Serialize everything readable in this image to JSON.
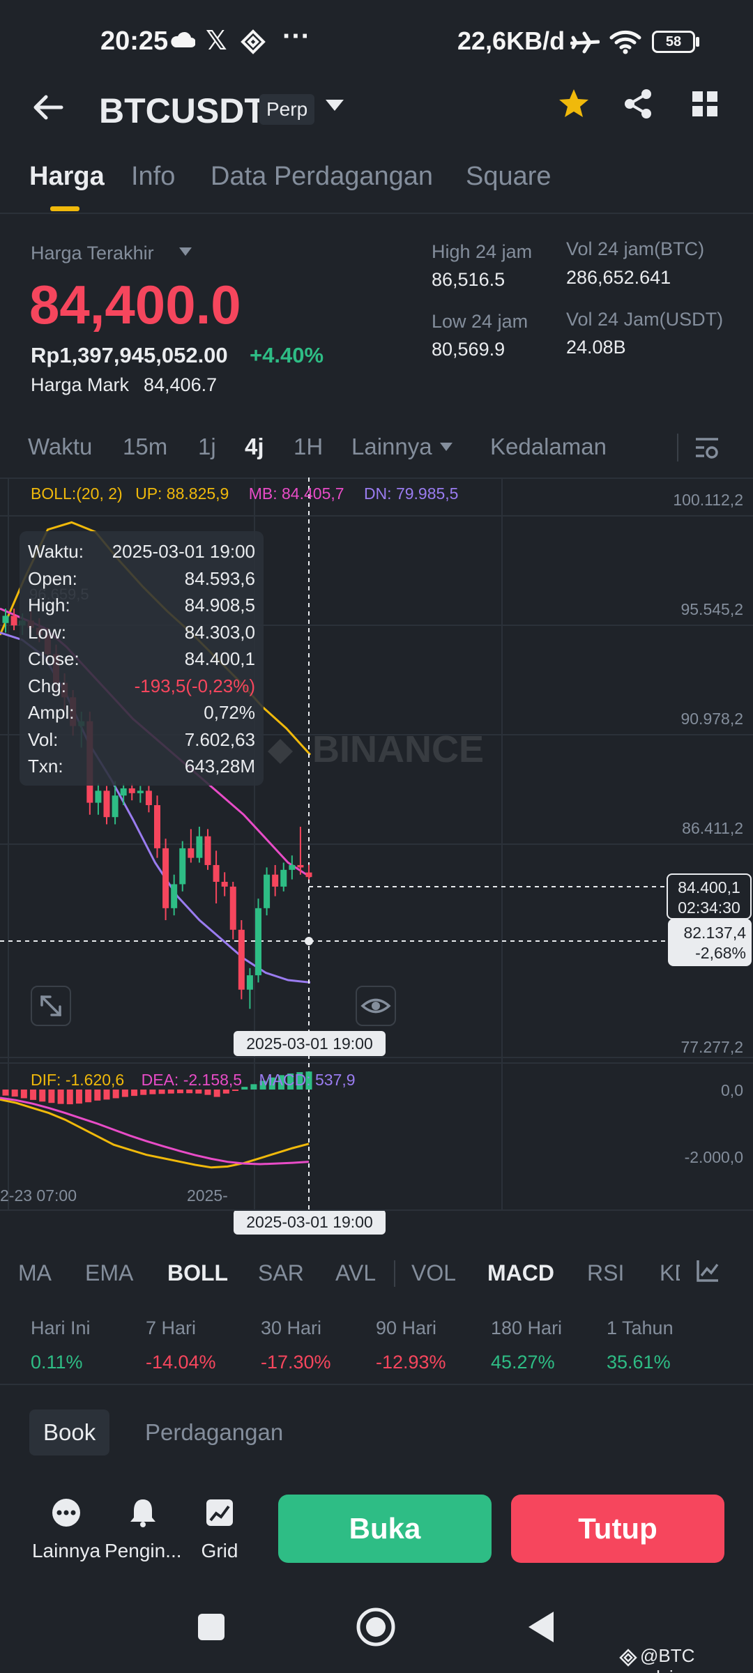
{
  "status_bar": {
    "time": "20:25",
    "network_speed": "22,6KB/d",
    "battery": "58"
  },
  "header": {
    "symbol": "BTCUSDT",
    "badge": "Perp"
  },
  "tabs": [
    {
      "label": "Harga"
    },
    {
      "label": "Info"
    },
    {
      "label": "Data Perdagangan"
    },
    {
      "label": "Square"
    }
  ],
  "price": {
    "last_label": "Harga Terakhir",
    "last_price": "84,400.0",
    "idr_price": "Rp1,397,945,052.00",
    "change_pct": "+4.40%",
    "mark_label": "Harga Mark",
    "mark_price": "84,406.7",
    "high_label": "High 24 jam",
    "high_value": "86,516.5",
    "low_label": "Low 24 jam",
    "low_value": "80,569.9",
    "vol_btc_label": "Vol 24 jam(BTC)",
    "vol_btc_value": "286,652.641",
    "vol_usdt_label": "Vol 24 Jam(USDT)",
    "vol_usdt_value": "24.08B"
  },
  "timeframes": {
    "waktu": "Waktu",
    "m15": "15m",
    "h1": "1j",
    "h4": "4j",
    "H1": "1H",
    "more": "Lainnya",
    "depth": "Kedalaman"
  },
  "chart": {
    "boll_label": "BOLL:(20, 2)",
    "up": "UP: 88.825,9",
    "mb": "MB: 84.405,7",
    "dn": "DN: 79.985,5",
    "prior_price_label": "96.659,5",
    "watermark": "BINANCE",
    "crosshair_date": "2025-03-01 19:00",
    "current_price_tag": "84.400,1",
    "countdown_tag": "02:34:30",
    "cursor_price_tag": "82.137,4",
    "cursor_pct_tag": "-2,68%",
    "macd_labels": {
      "dif": "DIF: -1.620,6",
      "dea": "DEA: -2.158,5",
      "macd": "MACD: 537,9"
    },
    "macd_axis": [
      "0,0",
      "-2.000,0"
    ],
    "x_labels": [
      "2-23 07:00",
      "2025-"
    ]
  },
  "tooltip": [
    {
      "k": "Waktu:",
      "v": "2025-03-01 19:00"
    },
    {
      "k": "Open:",
      "v": "84.593,6"
    },
    {
      "k": "High:",
      "v": "84.908,5"
    },
    {
      "k": "Low:",
      "v": "84.303,0"
    },
    {
      "k": "Close:",
      "v": "84.400,1"
    },
    {
      "k": "Chg:",
      "v": "-193,5(-0,23%)"
    },
    {
      "k": "Ampl:",
      "v": "0,72%"
    },
    {
      "k": "Vol:",
      "v": "7.602,63"
    },
    {
      "k": "Txn:",
      "v": "643,28M"
    }
  ],
  "indicators": [
    "MA",
    "EMA",
    "BOLL",
    "SAR",
    "AVL",
    "VOL",
    "MACD",
    "RSI",
    "KD"
  ],
  "performance": [
    {
      "label": "Hari Ini",
      "value": "0.11%"
    },
    {
      "label": "7 Hari",
      "value": "-14.04%"
    },
    {
      "label": "30 Hari",
      "value": "-17.30%"
    },
    {
      "label": "90 Hari",
      "value": "-12.93%"
    },
    {
      "label": "180 Hari",
      "value": "45.27%"
    },
    {
      "label": "1 Tahun",
      "value": "35.61%"
    }
  ],
  "book_tabs": {
    "book": "Book",
    "trades": "Perdagangan"
  },
  "actions": {
    "more": "Lainnya",
    "alert": "Pengin...",
    "grid": "Grid"
  },
  "buttons": {
    "open": "Buka",
    "close": "Tutup"
  },
  "credit": "@BTC advisor",
  "chart_data": {
    "type": "candlestick",
    "y_axis_ticks": [
      "100.112,2",
      "95.545,2",
      "90.978,2",
      "86.411,2",
      "77.277,2"
    ],
    "candles": [
      {
        "o": 95.0,
        "h": 95.6,
        "l": 94.6,
        "c": 95.3
      },
      {
        "o": 95.3,
        "h": 95.6,
        "l": 94.7,
        "c": 94.9
      },
      {
        "o": 94.9,
        "h": 95.4,
        "l": 94.5,
        "c": 95.1
      },
      {
        "o": 95.1,
        "h": 95.5,
        "l": 94.6,
        "c": 94.8
      },
      {
        "o": 94.8,
        "h": 95.2,
        "l": 94.2,
        "c": 94.5
      },
      {
        "o": 94.5,
        "h": 94.8,
        "l": 93.4,
        "c": 93.7
      },
      {
        "o": 93.7,
        "h": 94.1,
        "l": 92.1,
        "c": 92.5
      },
      {
        "o": 92.5,
        "h": 92.9,
        "l": 91.4,
        "c": 91.9
      },
      {
        "o": 91.9,
        "h": 92.2,
        "l": 90.3,
        "c": 90.7
      },
      {
        "o": 90.7,
        "h": 91.3,
        "l": 89.8,
        "c": 90.9
      },
      {
        "o": 90.9,
        "h": 91.3,
        "l": 87.0,
        "c": 87.5
      },
      {
        "o": 87.5,
        "h": 88.3,
        "l": 87.0,
        "c": 88.0
      },
      {
        "o": 88.0,
        "h": 88.2,
        "l": 86.6,
        "c": 86.9
      },
      {
        "o": 86.9,
        "h": 88.4,
        "l": 86.6,
        "c": 87.8
      },
      {
        "o": 87.8,
        "h": 88.3,
        "l": 87.4,
        "c": 88.1
      },
      {
        "o": 88.1,
        "h": 88.3,
        "l": 87.6,
        "c": 87.9
      },
      {
        "o": 87.9,
        "h": 88.2,
        "l": 87.5,
        "c": 88.0
      },
      {
        "o": 88.0,
        "h": 88.2,
        "l": 87.1,
        "c": 87.4
      },
      {
        "o": 87.4,
        "h": 87.8,
        "l": 85.2,
        "c": 85.6
      },
      {
        "o": 85.6,
        "h": 86.0,
        "l": 82.6,
        "c": 83.1
      },
      {
        "o": 83.1,
        "h": 84.5,
        "l": 82.8,
        "c": 84.1
      },
      {
        "o": 84.1,
        "h": 85.9,
        "l": 83.8,
        "c": 85.6
      },
      {
        "o": 85.6,
        "h": 86.4,
        "l": 85.0,
        "c": 85.2
      },
      {
        "o": 85.2,
        "h": 86.5,
        "l": 85.0,
        "c": 86.1
      },
      {
        "o": 86.1,
        "h": 86.4,
        "l": 84.7,
        "c": 84.9
      },
      {
        "o": 84.9,
        "h": 85.5,
        "l": 83.3,
        "c": 84.2
      },
      {
        "o": 84.2,
        "h": 84.6,
        "l": 83.6,
        "c": 84.0
      },
      {
        "o": 84.0,
        "h": 84.2,
        "l": 81.8,
        "c": 82.2
      },
      {
        "o": 82.2,
        "h": 82.6,
        "l": 79.3,
        "c": 79.7
      },
      {
        "o": 79.7,
        "h": 80.6,
        "l": 78.9,
        "c": 80.3
      },
      {
        "o": 80.3,
        "h": 83.5,
        "l": 80.0,
        "c": 83.1
      },
      {
        "o": 83.1,
        "h": 84.8,
        "l": 82.8,
        "c": 84.5
      },
      {
        "o": 84.5,
        "h": 84.9,
        "l": 83.6,
        "c": 84.0
      },
      {
        "o": 84.0,
        "h": 85.0,
        "l": 83.8,
        "c": 84.7
      },
      {
        "o": 84.7,
        "h": 85.3,
        "l": 84.3,
        "c": 84.9
      },
      {
        "o": 84.9,
        "h": 86.5,
        "l": 84.5,
        "c": 84.8
      },
      {
        "o": 84.59,
        "h": 84.91,
        "l": 84.3,
        "c": 84.4
      }
    ],
    "boll_up": [
      97.6,
      97.9,
      98.0,
      97.5,
      96.8,
      96.0,
      95.2,
      94.4,
      93.6,
      92.8,
      92.0,
      91.2,
      90.4,
      89.6,
      88.8
    ],
    "boll_mb": [
      95.6,
      95.2,
      94.8,
      94.0,
      93.0,
      92.0,
      91.0,
      90.2,
      89.4,
      88.6,
      87.8,
      87.0,
      86.0,
      85.0,
      84.4
    ],
    "boll_dn": [
      94.6,
      94.3,
      93.6,
      92.0,
      90.0,
      88.5,
      86.8,
      85.0,
      83.6,
      82.6,
      81.8,
      81.0,
      80.4,
      80.1,
      80.0
    ],
    "macd_hist": [
      -180,
      -210,
      -260,
      -310,
      -360,
      -400,
      -430,
      -440,
      -420,
      -380,
      -330,
      -300,
      -260,
      -220,
      -190,
      -160,
      -140,
      -130,
      -120,
      -110,
      -110,
      -120,
      -160,
      -220,
      -120,
      -20,
      80,
      160,
      260,
      360,
      430,
      480,
      520,
      537.9
    ],
    "dif": [
      -300,
      -400,
      -550,
      -700,
      -900,
      -1150,
      -1400,
      -1650,
      -1800,
      -1950,
      -2050,
      -2150,
      -2250,
      -2330,
      -2300,
      -2200,
      -2050,
      -1900,
      -1750,
      -1620.6
    ],
    "dea": [
      -250,
      -320,
      -420,
      -550,
      -700,
      -860,
      -1020,
      -1200,
      -1380,
      -1540,
      -1690,
      -1830,
      -1960,
      -2070,
      -2160,
      -2210,
      -2230,
      -2210,
      -2190,
      -2158.5
    ]
  },
  "colors": {
    "up": "#2ebd85",
    "down": "#f6465d",
    "boll_up": "#f0b90b",
    "boll_mb": "#e84cc7",
    "boll_dn": "#9a7cf0",
    "accent": "#f0b90b"
  }
}
